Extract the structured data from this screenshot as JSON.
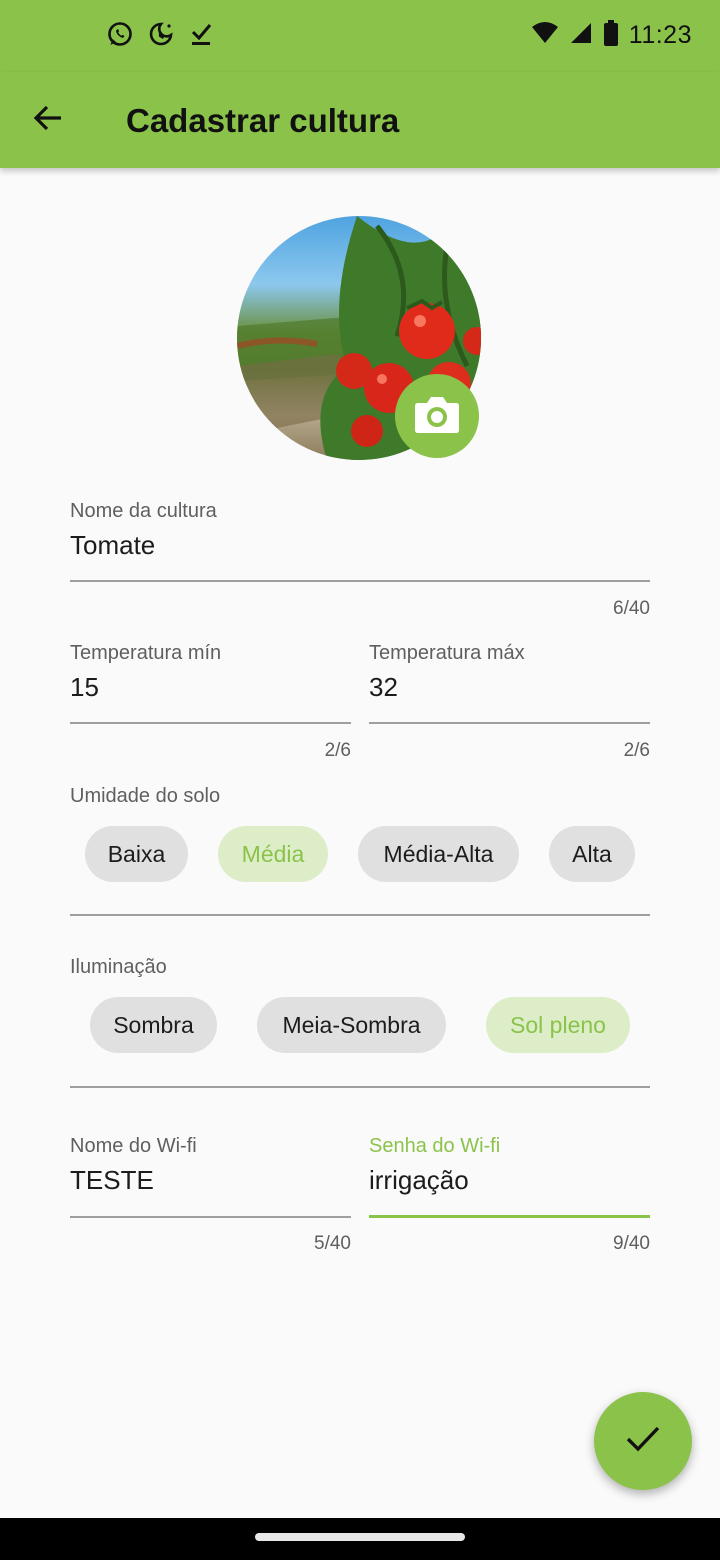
{
  "status_bar": {
    "time": "11:23",
    "left_icons": [
      "whatsapp-icon",
      "moon-alarm-icon",
      "download-check-icon"
    ],
    "right_icons": [
      "wifi-icon",
      "signal-icon",
      "battery-icon"
    ]
  },
  "app_bar": {
    "title": "Cadastrar cultura",
    "back_icon": "arrow-left-icon"
  },
  "photo": {
    "camera_icon": "camera-icon"
  },
  "form": {
    "crop_name": {
      "label": "Nome da cultura",
      "value": "Tomate",
      "counter": "6/40"
    },
    "temp_min": {
      "label": "Temperatura mín",
      "value": "15",
      "counter": "2/6"
    },
    "temp_max": {
      "label": "Temperatura máx",
      "value": "32",
      "counter": "2/6"
    },
    "soil_humidity": {
      "label": "Umidade do solo",
      "options": [
        "Baixa",
        "Média",
        "Média-Alta",
        "Alta"
      ],
      "selected": "Média"
    },
    "lighting": {
      "label": "Iluminação",
      "options": [
        "Sombra",
        "Meia-Sombra",
        "Sol pleno"
      ],
      "selected": "Sol pleno"
    },
    "wifi_name": {
      "label": "Nome do Wi-fi",
      "value": "TESTE",
      "counter": "5/40"
    },
    "wifi_password": {
      "label": "Senha do Wi-fi",
      "value": "irrigação",
      "counter": "9/40",
      "focused": true
    }
  },
  "fab": {
    "icon": "check-icon"
  },
  "colors": {
    "primary": "#8bc34a",
    "chip_selected_bg": "#dcedc8",
    "chip_bg": "#e0e0e0",
    "background": "#fafafa"
  }
}
